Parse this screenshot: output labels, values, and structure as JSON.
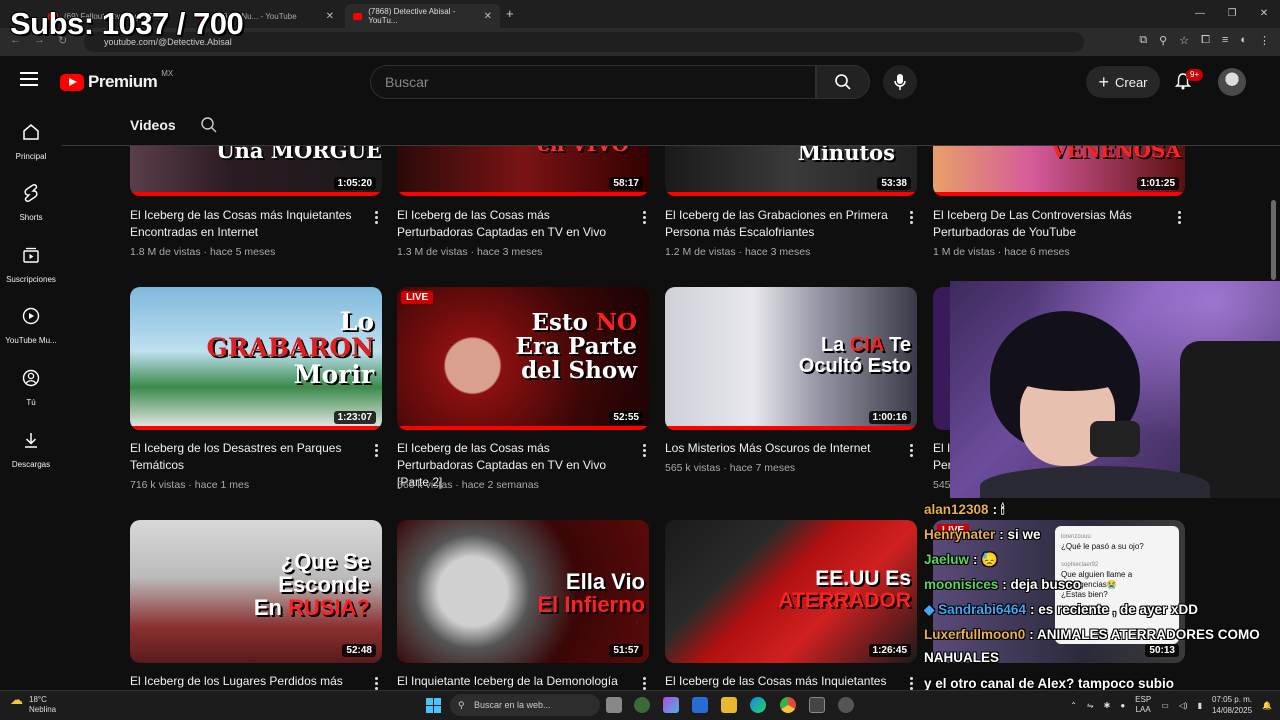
{
  "overlay": {
    "subs": "Subs: 1037 / 700"
  },
  "browser": {
    "tabs": [
      {
        "label": "(69) Fallout New Vegas Pa..."
      },
      {
        "label": "(7868) Nu... - YouTube"
      },
      {
        "label": "(7868) Detective Abisal - YouTu..."
      }
    ],
    "url": "youtube.com/@Detective.Abisal"
  },
  "youtube": {
    "logo_word": "Premium",
    "country": "MX",
    "search_placeholder": "Buscar",
    "create_label": "Crear",
    "notif_badge": "9+"
  },
  "sidebar": {
    "items": [
      {
        "label": "Principal"
      },
      {
        "label": "Shorts"
      },
      {
        "label": "Suscripciones"
      },
      {
        "label": "YouTube Mu..."
      },
      {
        "label": "Tú"
      },
      {
        "label": "Descargas"
      }
    ]
  },
  "channel": {
    "tab_videos": "Videos"
  },
  "videos": [
    {
      "title": "El Iceberg de las Cosas más Inquietantes Encontradas en Internet",
      "views": "1.8 M de vistas",
      "age": "hace 5 meses",
      "duration": "1:05:20",
      "thumb_text": "Una MORGUE"
    },
    {
      "title": "El Iceberg de las Cosas más Perturbadoras Captadas en TV en Vivo",
      "views": "1.3 M de vistas",
      "age": "hace 3 meses",
      "duration": "58:17",
      "thumb_text": "en VIVO"
    },
    {
      "title": "El Iceberg de las Grabaciones en Primera Persona más Escalofriantes",
      "views": "1.2 M de vistas",
      "age": "hace 3 meses",
      "duration": "53:38",
      "thumb_text": "Minutos"
    },
    {
      "title": "El Iceberg De Las Controversias Más Perturbadoras de YouTube",
      "views": "1 M de vistas",
      "age": "hace 6 meses",
      "duration": "1:01:25",
      "thumb_text": "VENENOSA"
    },
    {
      "title": "El Iceberg de los Desastres en Parques Temáticos",
      "views": "716 k vistas",
      "age": "hace 1 mes",
      "duration": "1:23:07",
      "thumb_l1": "Lo",
      "thumb_l2": "GRABARON",
      "thumb_l3": "Morir"
    },
    {
      "title": "El Iceberg de las Cosas más Perturbadoras Captadas en TV en Vivo [Parte 2]",
      "views": "566 k vistas",
      "age": "hace 2 semanas",
      "duration": "52:55",
      "live": "LIVE",
      "thumb_l1a": "Esto",
      "thumb_l1b": "NO",
      "thumb_l2": "Era Parte",
      "thumb_l3": "del Show"
    },
    {
      "title": "Los Misterios Más Oscuros de Internet",
      "views": "565 k vistas",
      "age": "hace 7 meses",
      "duration": "1:00:16",
      "thumb_l1a": "La",
      "thumb_l1b": "CIA",
      "thumb_l1c": "Te",
      "thumb_l2": "Ocultó Esto"
    },
    {
      "title_partial": "El I",
      "title_partial2": "Per",
      "views_partial": "545"
    },
    {
      "title": "El Iceberg de los Lugares Perdidos más",
      "duration": "52:48",
      "thumb_l1": "¿Que Se",
      "thumb_l2": "Esconde",
      "thumb_l3a": "En",
      "thumb_l3b": "RUSIA?"
    },
    {
      "title": "El Inquietante Iceberg de la Demonología",
      "duration": "51:57",
      "thumb_l1": "Ella Vio",
      "thumb_l2": "El Infierno"
    },
    {
      "title": "El Iceberg de las Cosas más Inquietantes de",
      "duration": "1:26:45",
      "thumb_l1": "EE.UU Es",
      "thumb_l2": "ATERRADOR"
    },
    {
      "duration": "50:13",
      "live": "LIVE",
      "comments": [
        "lorenzouuu",
        "¿Qué le pasó a su ojo?",
        "sophieclaer92",
        "Que alguien llame a emergencias😭",
        "¿Estas bien?"
      ]
    }
  ],
  "chat": [
    {
      "user": "alan12308",
      "msg": ": 🕯",
      "color": "#e8b04b"
    },
    {
      "user": "Henrynater",
      "msg": ": si we",
      "color": "#e8b04b"
    },
    {
      "user": "Jaeluw",
      "msg": ": 😓",
      "color": "#5fd35f"
    },
    {
      "user": "moonisices",
      "msg": ": deja busco",
      "color": "#5fd35f"
    },
    {
      "user": "Sandrabi6464",
      "msg": ": es reciente , de ayer xDD",
      "color": "#3fa9f5"
    },
    {
      "user": "Luxerfullmoon0",
      "msg": ": ANIMALES ATERRADORES COMO",
      "color": "#e8b04b"
    },
    {
      "user": "",
      "msg": "NAHUALES",
      "color": "#ffffff"
    },
    {
      "user": "",
      "msg": "y el otro canal de Alex? tampoco subio",
      "color": "#ffffff"
    }
  ],
  "taskbar": {
    "temp": "18°C",
    "weather": "Neblina",
    "search": "Buscar en la web...",
    "lang1": "ESP",
    "lang2": "LAA",
    "time": "07:05 p. m.",
    "date": "14/08/2025"
  }
}
